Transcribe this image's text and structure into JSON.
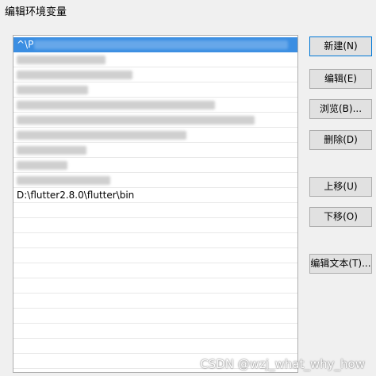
{
  "dialog": {
    "title": "编辑环境变量"
  },
  "list": {
    "visible_entry": "D:\\flutter2.8.0\\flutter\\bin",
    "selected_fragment": "^\\P"
  },
  "buttons": {
    "new": "新建(N)",
    "edit": "编辑(E)",
    "browse": "浏览(B)...",
    "delete": "删除(D)",
    "move_up": "上移(U)",
    "move_down": "下移(O)",
    "edit_text": "编辑文本(T)..."
  },
  "watermark": "CSDN @wzj_what_why_how"
}
